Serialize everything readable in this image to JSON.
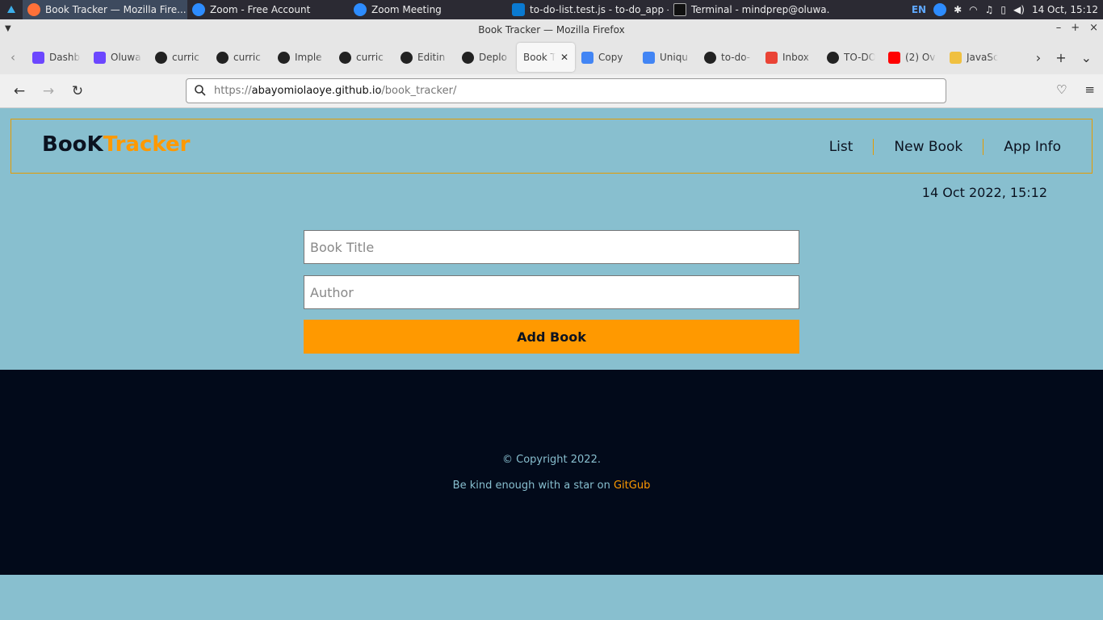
{
  "taskbar": {
    "tasks": [
      {
        "label": "Book Tracker — Mozilla Fire...",
        "active": true
      },
      {
        "label": "Zoom - Free Account"
      },
      {
        "label": "Zoom Meeting"
      },
      {
        "label": "to-do-list.test.js - to-do_app -..."
      },
      {
        "label": "Terminal - mindprep@oluwa..."
      }
    ],
    "lang": "EN",
    "clock": "14 Oct, 15:12"
  },
  "window": {
    "title": "Book Tracker — Mozilla Firefox"
  },
  "tabs": [
    {
      "label": "Dashb",
      "icon": "dashboard-icon",
      "color": "#6c47ff"
    },
    {
      "label": "Oluwa",
      "icon": "dashboard-icon",
      "color": "#6c47ff"
    },
    {
      "label": "curric",
      "icon": "github-icon"
    },
    {
      "label": "curric",
      "icon": "github-icon"
    },
    {
      "label": "Imple",
      "icon": "github-icon"
    },
    {
      "label": "curric",
      "icon": "github-icon"
    },
    {
      "label": "Editin",
      "icon": "github-icon"
    },
    {
      "label": "Deplo",
      "icon": "github-icon"
    },
    {
      "label": "Book Tr",
      "active": true
    },
    {
      "label": "Copy",
      "icon": "docs-icon",
      "color": "#4285f4"
    },
    {
      "label": "Uniqu",
      "icon": "docs-icon",
      "color": "#4285f4"
    },
    {
      "label": "to-do-",
      "icon": "github-icon"
    },
    {
      "label": "Inbox",
      "icon": "gmail-icon",
      "color": "#ea4335"
    },
    {
      "label": "TO-DO",
      "icon": "github-icon"
    },
    {
      "label": "(2) Ov",
      "icon": "youtube-icon",
      "color": "#ff0000"
    },
    {
      "label": "JavaSc",
      "icon": "js-icon",
      "color": "#f0c040"
    }
  ],
  "url": {
    "prefix": "https://",
    "host": "abayomiolaoye.github.io",
    "path": "/book_tracker/"
  },
  "site": {
    "logo_a": "Boo",
    "logo_b": "Tracker",
    "nav": [
      "List",
      "New Book",
      "App Info"
    ],
    "datetime": "14 Oct 2022, 15:12",
    "form": {
      "title_placeholder": "Book Title",
      "author_placeholder": "Author",
      "add_label": "Add Book"
    },
    "footer": {
      "copyright": "© Copyright 2022.",
      "star_text": "Be kind enough with a star on ",
      "star_link": "GitGub"
    }
  }
}
